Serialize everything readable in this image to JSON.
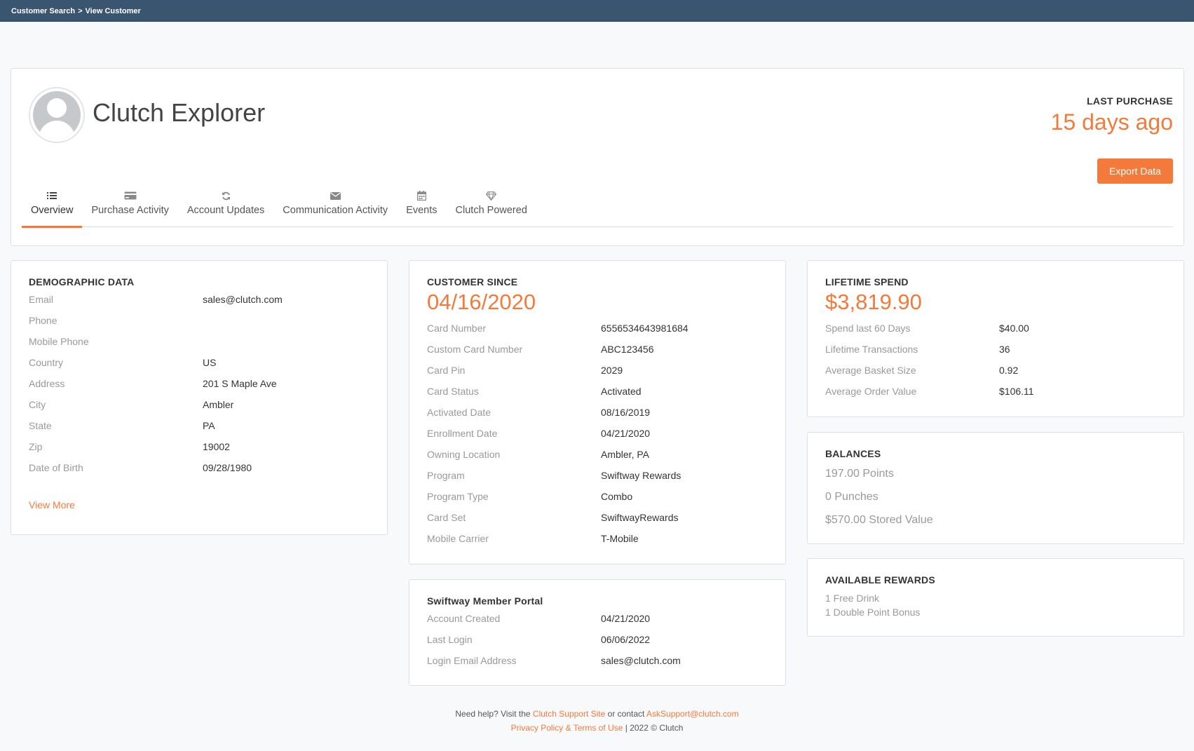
{
  "breadcrumb": {
    "root": "Customer Search",
    "separator": ">",
    "current": "View Customer"
  },
  "customer": {
    "name": "Clutch Explorer"
  },
  "last_purchase": {
    "label": "LAST PURCHASE",
    "value": "15 days ago"
  },
  "export_button": "Export Data",
  "tabs": [
    {
      "label": "Overview",
      "icon": "list-icon",
      "active": true
    },
    {
      "label": "Purchase Activity",
      "icon": "credit-card-icon"
    },
    {
      "label": "Account Updates",
      "icon": "refresh-icon"
    },
    {
      "label": "Communication Activity",
      "icon": "envelope-icon"
    },
    {
      "label": "Events",
      "icon": "calendar-icon"
    },
    {
      "label": "Clutch Powered",
      "icon": "diamond-icon"
    }
  ],
  "demographic": {
    "title": "DEMOGRAPHIC DATA",
    "rows": [
      {
        "label": "Email",
        "value": "sales@clutch.com"
      },
      {
        "label": "Phone",
        "value": ""
      },
      {
        "label": "Mobile Phone",
        "value": ""
      },
      {
        "label": "Country",
        "value": "US"
      },
      {
        "label": "Address",
        "value": "201 S Maple Ave"
      },
      {
        "label": "City",
        "value": "Ambler"
      },
      {
        "label": "State",
        "value": "PA"
      },
      {
        "label": "Zip",
        "value": "19002"
      },
      {
        "label": "Date of Birth",
        "value": "09/28/1980"
      }
    ],
    "view_more": "View More"
  },
  "customer_since": {
    "title": "CUSTOMER SINCE",
    "value": "04/16/2020",
    "rows": [
      {
        "label": "Card Number",
        "value": "6556534643981684"
      },
      {
        "label": "Custom Card Number",
        "value": "ABC123456"
      },
      {
        "label": "Card Pin",
        "value": "2029"
      },
      {
        "label": "Card Status",
        "value": "Activated"
      },
      {
        "label": "Activated Date",
        "value": "08/16/2019"
      },
      {
        "label": "Enrollment Date",
        "value": "04/21/2020"
      },
      {
        "label": "Owning Location",
        "value": "Ambler, PA"
      },
      {
        "label": "Program",
        "value": "Swiftway Rewards"
      },
      {
        "label": "Program Type",
        "value": "Combo"
      },
      {
        "label": "Card Set",
        "value": "SwiftwayRewards"
      },
      {
        "label": "Mobile Carrier",
        "value": "T-Mobile"
      }
    ]
  },
  "member_portal": {
    "title": "Swiftway Member Portal",
    "rows": [
      {
        "label": "Account Created",
        "value": "04/21/2020"
      },
      {
        "label": "Last Login",
        "value": "06/06/2022"
      },
      {
        "label": "Login Email Address",
        "value": "sales@clutch.com"
      }
    ]
  },
  "lifetime_spend": {
    "title": "LIFETIME SPEND",
    "value": "$3,819.90",
    "rows": [
      {
        "label": "Spend last 60 Days",
        "value": "$40.00"
      },
      {
        "label": "Lifetime Transactions",
        "value": "36"
      },
      {
        "label": "Average Basket Size",
        "value": "0.92"
      },
      {
        "label": "Average Order Value",
        "value": "$106.11"
      }
    ]
  },
  "balances": {
    "title": "BALANCES",
    "items": [
      "197.00 Points",
      "0 Punches",
      "$570.00 Stored Value"
    ]
  },
  "rewards": {
    "title": "AVAILABLE REWARDS",
    "items": [
      "1 Free Drink",
      "1 Double Point Bonus"
    ]
  },
  "footer": {
    "help_prefix": "Need help? Visit the",
    "support_link": "Clutch Support Site",
    "or_contact": "or contact",
    "email_link": "AskSupport@clutch.com",
    "terms_link": "Privacy Policy & Terms of Use",
    "copyright": "| 2022 © Clutch"
  },
  "colors": {
    "accent": "#f47a3c",
    "topbar": "#3a5570",
    "muted": "#999999"
  }
}
